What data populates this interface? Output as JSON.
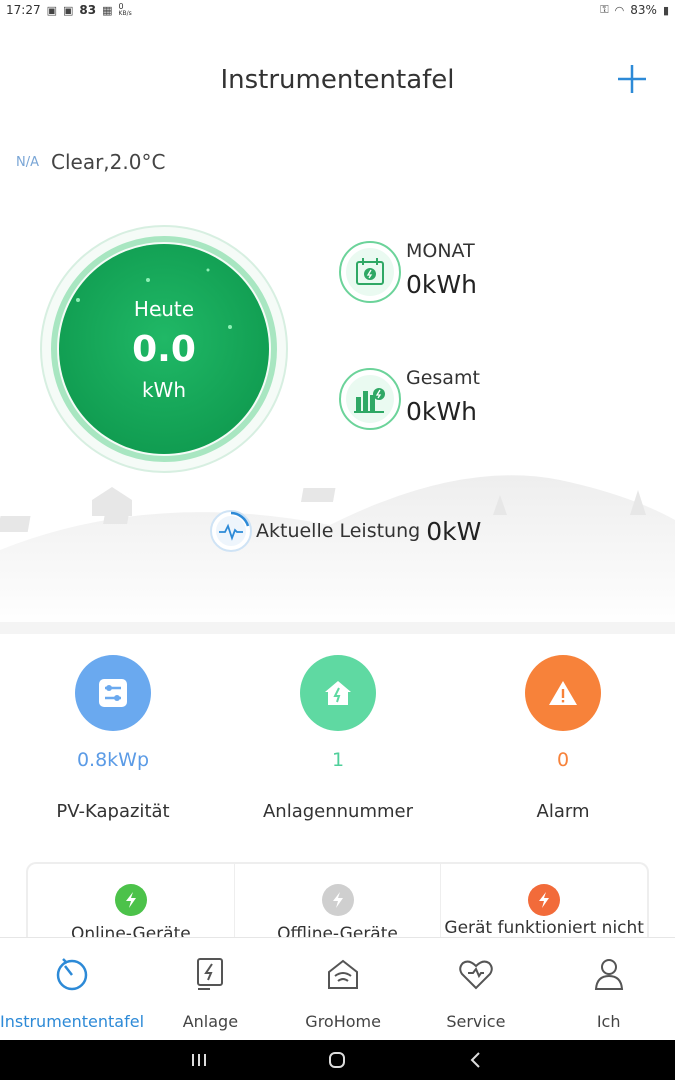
{
  "status_bar": {
    "time": "17:27",
    "speed_value": "83",
    "speed_small": "0",
    "speed_unit": "KB/s",
    "battery": "83%"
  },
  "header": {
    "title": "Instrumententafel",
    "add_icon": "plus-icon"
  },
  "weather": {
    "badge": "N/A",
    "condition": "Clear,2.0°C"
  },
  "today": {
    "label": "Heute",
    "value": "0.0",
    "unit": "kWh"
  },
  "stats": {
    "month": {
      "label": "MONAT",
      "value": "0kWh",
      "icon": "calendar-energy-icon"
    },
    "total": {
      "label": "Gesamt",
      "value": "0kWh",
      "icon": "bar-chart-icon"
    }
  },
  "power": {
    "label": "Aktuelle Leistung",
    "value": "0kW",
    "icon": "pulse-icon"
  },
  "summary": {
    "capacity": {
      "value": "0.8kWp",
      "caption": "PV-Kapazität",
      "color": "#5b9be6"
    },
    "plants": {
      "value": "1",
      "caption": "Anlagennummer",
      "color": "#4fcf9a"
    },
    "alarm": {
      "value": "0",
      "caption": "Alarm",
      "color": "#f7823a"
    }
  },
  "device_cards": {
    "online": {
      "label": "Online-Geräte",
      "color": "#4cc24a"
    },
    "offline": {
      "label": "Offline-Geräte",
      "color": "#cfcfcf"
    },
    "fault": {
      "label": "Gerät funktioniert nicht",
      "color": "#f26b3a"
    }
  },
  "tabs": [
    {
      "label": "Instrumententafel",
      "icon": "dashboard-icon",
      "active": true
    },
    {
      "label": "Anlage",
      "icon": "plant-icon",
      "active": false
    },
    {
      "label": "GroHome",
      "icon": "home-icon",
      "active": false
    },
    {
      "label": "Service",
      "icon": "heart-icon",
      "active": false
    },
    {
      "label": "Ich",
      "icon": "user-icon",
      "active": false
    }
  ],
  "colors": {
    "accent": "#2d8ad7",
    "gauge_green": "#17a85a"
  }
}
